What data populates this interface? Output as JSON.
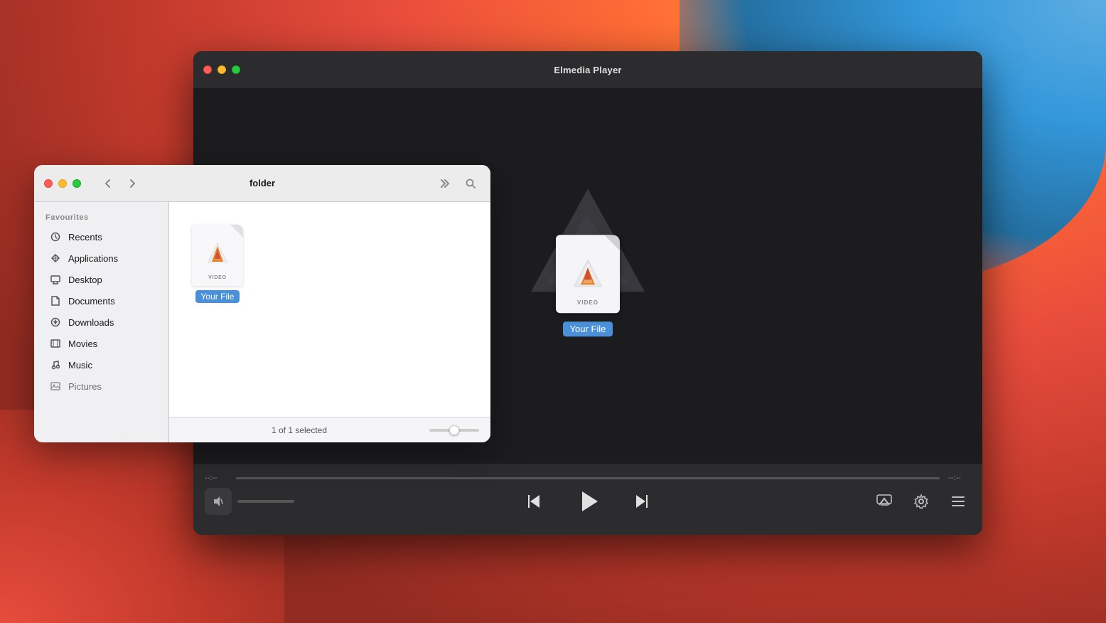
{
  "desktop": {
    "bg": "macOS desktop"
  },
  "player": {
    "title": "Elmedia Player",
    "traffic_lights": [
      "close",
      "minimize",
      "maximize"
    ],
    "file_name": "Your File",
    "file_type": "VIDEO",
    "time_start": "--:--",
    "time_end": "--:--",
    "controls": {
      "prev_label": "previous",
      "play_label": "play",
      "next_label": "next",
      "airplay_label": "airplay",
      "settings_label": "settings",
      "playlist_label": "playlist"
    }
  },
  "finder": {
    "title": "folder",
    "traffic_lights": [
      "close",
      "minimize",
      "maximize"
    ],
    "sidebar": {
      "section": "Favourites",
      "items": [
        {
          "label": "Recents",
          "icon": "clock"
        },
        {
          "label": "Applications",
          "icon": "grid"
        },
        {
          "label": "Desktop",
          "icon": "desktop"
        },
        {
          "label": "Documents",
          "icon": "document"
        },
        {
          "label": "Downloads",
          "icon": "download"
        },
        {
          "label": "Movies",
          "icon": "film"
        },
        {
          "label": "Music",
          "icon": "music"
        },
        {
          "label": "Pictures",
          "icon": "photo"
        }
      ]
    },
    "content": {
      "files": [
        {
          "name": "Your File",
          "type": "VIDEO"
        }
      ]
    },
    "status": "1 of 1 selected"
  }
}
